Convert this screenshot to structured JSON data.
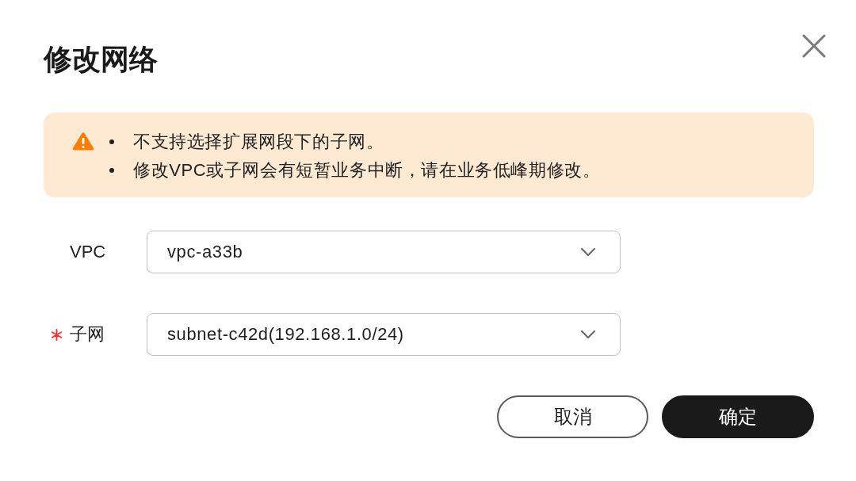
{
  "dialog": {
    "title": "修改网络"
  },
  "alert": {
    "kind": "warning",
    "items": [
      "不支持选择扩展网段下的子网。",
      "修改VPC或子网会有短暂业务中断，请在业务低峰期修改。"
    ]
  },
  "fields": [
    {
      "label": "VPC",
      "required": false,
      "value": "vpc-a33b"
    },
    {
      "label": "子网",
      "required": true,
      "value": "subnet-c42d(192.168.1.0/24)"
    }
  ],
  "buttons": [
    {
      "label": "取消",
      "kind": "secondary"
    },
    {
      "label": "确定",
      "kind": "primary"
    }
  ]
}
